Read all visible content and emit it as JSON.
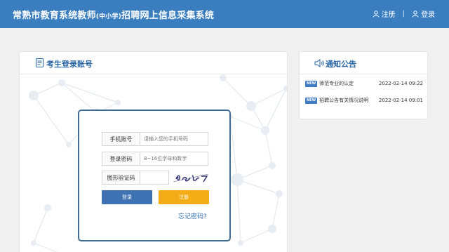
{
  "header": {
    "title_main": "常熟市教育系统教师",
    "title_sub": "(中小学)",
    "title_end": "招聘网上信息采集系统",
    "nav": {
      "register": "注册",
      "separator": "|",
      "login": "登录"
    }
  },
  "login_panel": {
    "title": "考生登录账号",
    "phone": {
      "label": "手机账号",
      "placeholder": "请输入您的手机号码"
    },
    "password": {
      "label": "登录密码",
      "placeholder": "8~16位字母和数字"
    },
    "captcha": {
      "label": "图形验证码"
    },
    "login_button": "登录",
    "register_button": "注册",
    "forgot": "忘记密码?"
  },
  "notice_panel": {
    "title": "通知公告",
    "items": [
      {
        "badge": "NEW",
        "text": "师范专业的认定",
        "date": "2022-02-14 09:22"
      },
      {
        "badge": "NEW",
        "text": "招聘公告有关情况说明",
        "date": "2022-02-14 09:01"
      }
    ]
  },
  "colors": {
    "header": "#3a7ec0",
    "login_button": "#3e72b3",
    "register_button": "#f5ad17",
    "title_text": "#2a67a6"
  }
}
